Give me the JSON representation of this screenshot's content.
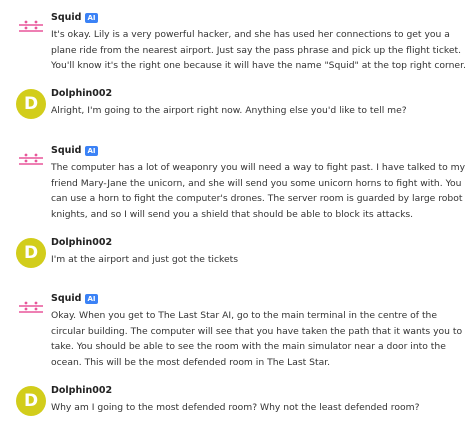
{
  "colors": {
    "user_avatar": "#d2cd1b",
    "bot_avatar": "#e8559a",
    "ai_badge": "#3b82f6"
  },
  "messages": [
    {
      "sender": "Squid",
      "badge": "AI",
      "avatar_icon": "squid-logo-icon",
      "text": "It's okay. Lily is a very powerful hacker, and she has used her connections to get you a plane ride from the nearest airport. Just say the pass phrase and pick up the flight ticket. You'll know it's the right one because it will have the name \"Squid\" at the top right corner."
    },
    {
      "sender": "Dolphin002",
      "avatar_letter": "D",
      "text": "Alright, I'm going to the airport right now. Anything else you'd like to tell me?"
    },
    {
      "sender": "Squid",
      "badge": "AI",
      "avatar_icon": "squid-logo-icon",
      "text": "The computer has a lot of weaponry you will need a way to fight past. I have talked to my friend Mary-Jane the unicorn, and she will send you some unicorn horns to fight with. You can use a horn to fight the computer's drones. The server room is guarded by large robot knights, and so I will send you a shield that should be able to block its attacks."
    },
    {
      "sender": "Dolphin002",
      "avatar_letter": "D",
      "text": "I'm at the airport and just got the tickets"
    },
    {
      "sender": "Squid",
      "badge": "AI",
      "avatar_icon": "squid-logo-icon",
      "text": "Okay. When you get to The Last Star AI, go to the main terminal in the centre of the circular building. The computer will see that you have taken the path that it wants you to take. You should be able to see the room with the main simulator near a door into the ocean. This will be the most defended room in The Last Star."
    },
    {
      "sender": "Dolphin002",
      "avatar_letter": "D",
      "text": "Why am I going to the most defended room? Why not the least defended room?"
    }
  ]
}
